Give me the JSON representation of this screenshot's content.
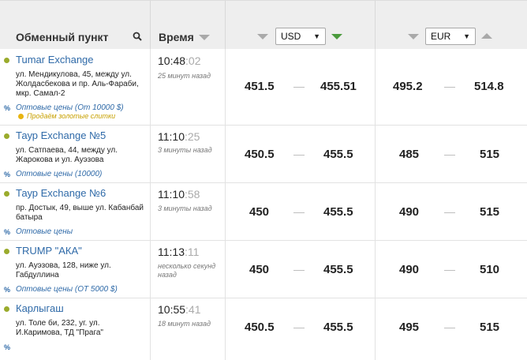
{
  "header": {
    "exchange_title": "Обменный пункт",
    "time_title": "Время",
    "usd": {
      "selected": "USD"
    },
    "eur": {
      "selected": "EUR"
    }
  },
  "colors": {
    "header_bg": "#eeeeee",
    "link": "#2f6aa8",
    "status_dot": "#9aab2c",
    "sort_active": "#4a9a3c",
    "gold_dot": "#e8b410"
  },
  "icons": {
    "search": "search-icon",
    "sort": "sort-triangle-icon"
  },
  "rows": [
    {
      "name": "Tumar Exchange",
      "address": "ул. Мендикулова, 45, между ул. Жолдасбекова и пр. Аль-Фараби, мкр. Самал-2",
      "wholesale": "Оптовые цены (От 10000 $)",
      "gold": "Продаём золотые слитки",
      "time": "10:48",
      "seconds": ":02",
      "ago": "25 минут назад",
      "usd_buy": "451.5",
      "usd_sell": "455.51",
      "eur_buy": "495.2",
      "eur_sell": "514.8"
    },
    {
      "name": "Таур Exchange №5",
      "address": "ул. Сатпаева, 44, между ул. Жарокова и ул. Ауэзова",
      "wholesale": "Оптовые цены (10000)",
      "time": "11:10",
      "seconds": ":25",
      "ago": "3 минуты назад",
      "usd_buy": "450.5",
      "usd_sell": "455.5",
      "eur_buy": "485",
      "eur_sell": "515"
    },
    {
      "name": "Таур Exchange №6",
      "address": "пр. Достык, 49, выше ул. Кабанбай батыра",
      "wholesale": "Оптовые цены",
      "time": "11:10",
      "seconds": ":58",
      "ago": "3 минуты назад",
      "usd_buy": "450",
      "usd_sell": "455.5",
      "eur_buy": "490",
      "eur_sell": "515"
    },
    {
      "name": "TRUMP \"АКА\"",
      "address": "ул. Ауэзова, 128, ниже ул. Габдуллина",
      "wholesale": "Оптовые цены (ОТ 5000 $)",
      "time": "11:13",
      "seconds": ":11",
      "ago": "несколько секунд назад",
      "usd_buy": "450",
      "usd_sell": "455.5",
      "eur_buy": "490",
      "eur_sell": "510"
    },
    {
      "name": "Карлыгаш",
      "address": "ул. Толе би, 232, уг. ул. И.Каримова, ТД \"Прага\"",
      "time": "10:55",
      "seconds": ":41",
      "ago": "18 минут назад",
      "usd_buy": "450.5",
      "usd_sell": "455.5",
      "eur_buy": "495",
      "eur_sell": "515"
    }
  ]
}
